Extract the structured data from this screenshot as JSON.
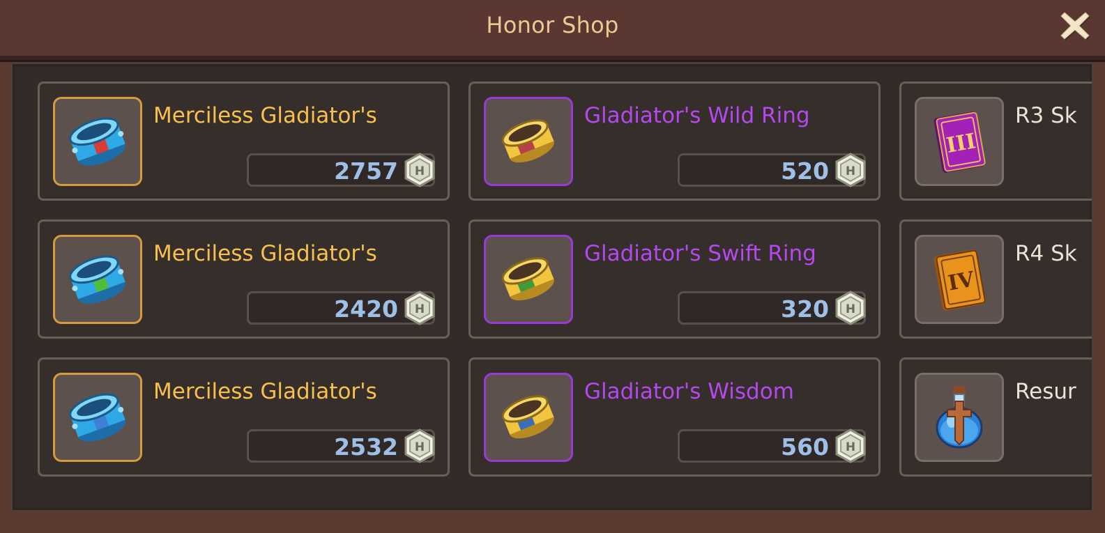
{
  "header": {
    "title": "Honor Shop"
  },
  "items": [
    {
      "name": "Merciless Gladiator's",
      "price": "2757",
      "rarity": "gold",
      "icon": "blue-bracelet-red-band-icon",
      "band": "#d93a3a"
    },
    {
      "name": "Gladiator's Wild Ring",
      "price": "520",
      "rarity": "purple",
      "icon": "gold-ring-red-band-icon",
      "band": "#b8404a"
    },
    {
      "name": "R3 Sk",
      "price": "",
      "rarity": "white",
      "icon": "skill-book-iii-icon"
    },
    {
      "name": "Merciless Gladiator's",
      "price": "2420",
      "rarity": "gold",
      "icon": "blue-bracelet-green-band-icon",
      "band": "#4fbf3a"
    },
    {
      "name": "Gladiator's Swift Ring",
      "price": "320",
      "rarity": "purple",
      "icon": "gold-ring-green-band-icon",
      "band": "#3f9a3a"
    },
    {
      "name": "R4 Sk",
      "price": "",
      "rarity": "white",
      "icon": "skill-book-iv-icon"
    },
    {
      "name": "Merciless Gladiator's",
      "price": "2532",
      "rarity": "gold",
      "icon": "blue-bracelet-blue-band-icon",
      "band": "#3f7fd6"
    },
    {
      "name": "Gladiator's Wisdom",
      "price": "560",
      "rarity": "purple",
      "icon": "gold-ring-blue-band-icon",
      "band": "#3a6fb8"
    },
    {
      "name": "Resur",
      "price": "",
      "rarity": "white",
      "icon": "resurrection-potion-icon"
    }
  ],
  "currency": {
    "symbol": "H",
    "icon": "honor-coin-icon"
  },
  "colors": {
    "gold": "#f8c04e",
    "purple": "#b548ee",
    "price": "#9fc0e6",
    "background": "#332b28"
  }
}
